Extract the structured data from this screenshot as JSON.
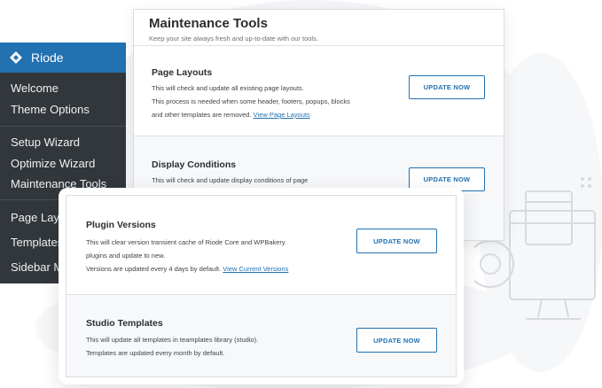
{
  "sidebar": {
    "brand": "Riode",
    "groups": [
      [
        "Welcome",
        "Theme Options"
      ],
      [
        "Setup Wizard",
        "Optimize Wizard",
        "Maintenance Tools"
      ],
      [
        "Page Layouts",
        "Templates",
        "Sidebar Manager"
      ]
    ]
  },
  "maintenance": {
    "title": "Maintenance Tools",
    "subtitle": "Keep your site always fresh and up-to-date with our tools."
  },
  "sections": {
    "page_layouts": {
      "title": "Page Layouts",
      "line1": "This will check and update all existing page layouts.",
      "line2": "This process is needed when some header, footers, popups, blocks",
      "line3": "and other templates are removed.",
      "link": "View Page Layouts",
      "button": "UPDATE NOW"
    },
    "display_conditions": {
      "title": "Display Conditions",
      "line1": "This will check and update display conditions of page",
      "button": "UPDATE NOW"
    },
    "plugin_versions": {
      "title": "Plugin Versions",
      "line1": "This will clear version transient cache of Riode Core and WPBakery",
      "line2": "plugins and update to new.",
      "line3": "Versions are updated every 4 days by default.",
      "link": "View Current Versions",
      "button": "UPDATE NOW"
    },
    "studio_templates": {
      "title": "Studio Templates",
      "line1": "This will update all templates in teamplates library (studio).",
      "line2": "Templates are updated every month by default.",
      "button": "UPDATE NOW"
    }
  },
  "colors": {
    "sidebar_bg": "#32373c",
    "brand_bg": "#2271b1",
    "accent": "#2271b1",
    "section_alt_bg": "#f7f8fa"
  }
}
